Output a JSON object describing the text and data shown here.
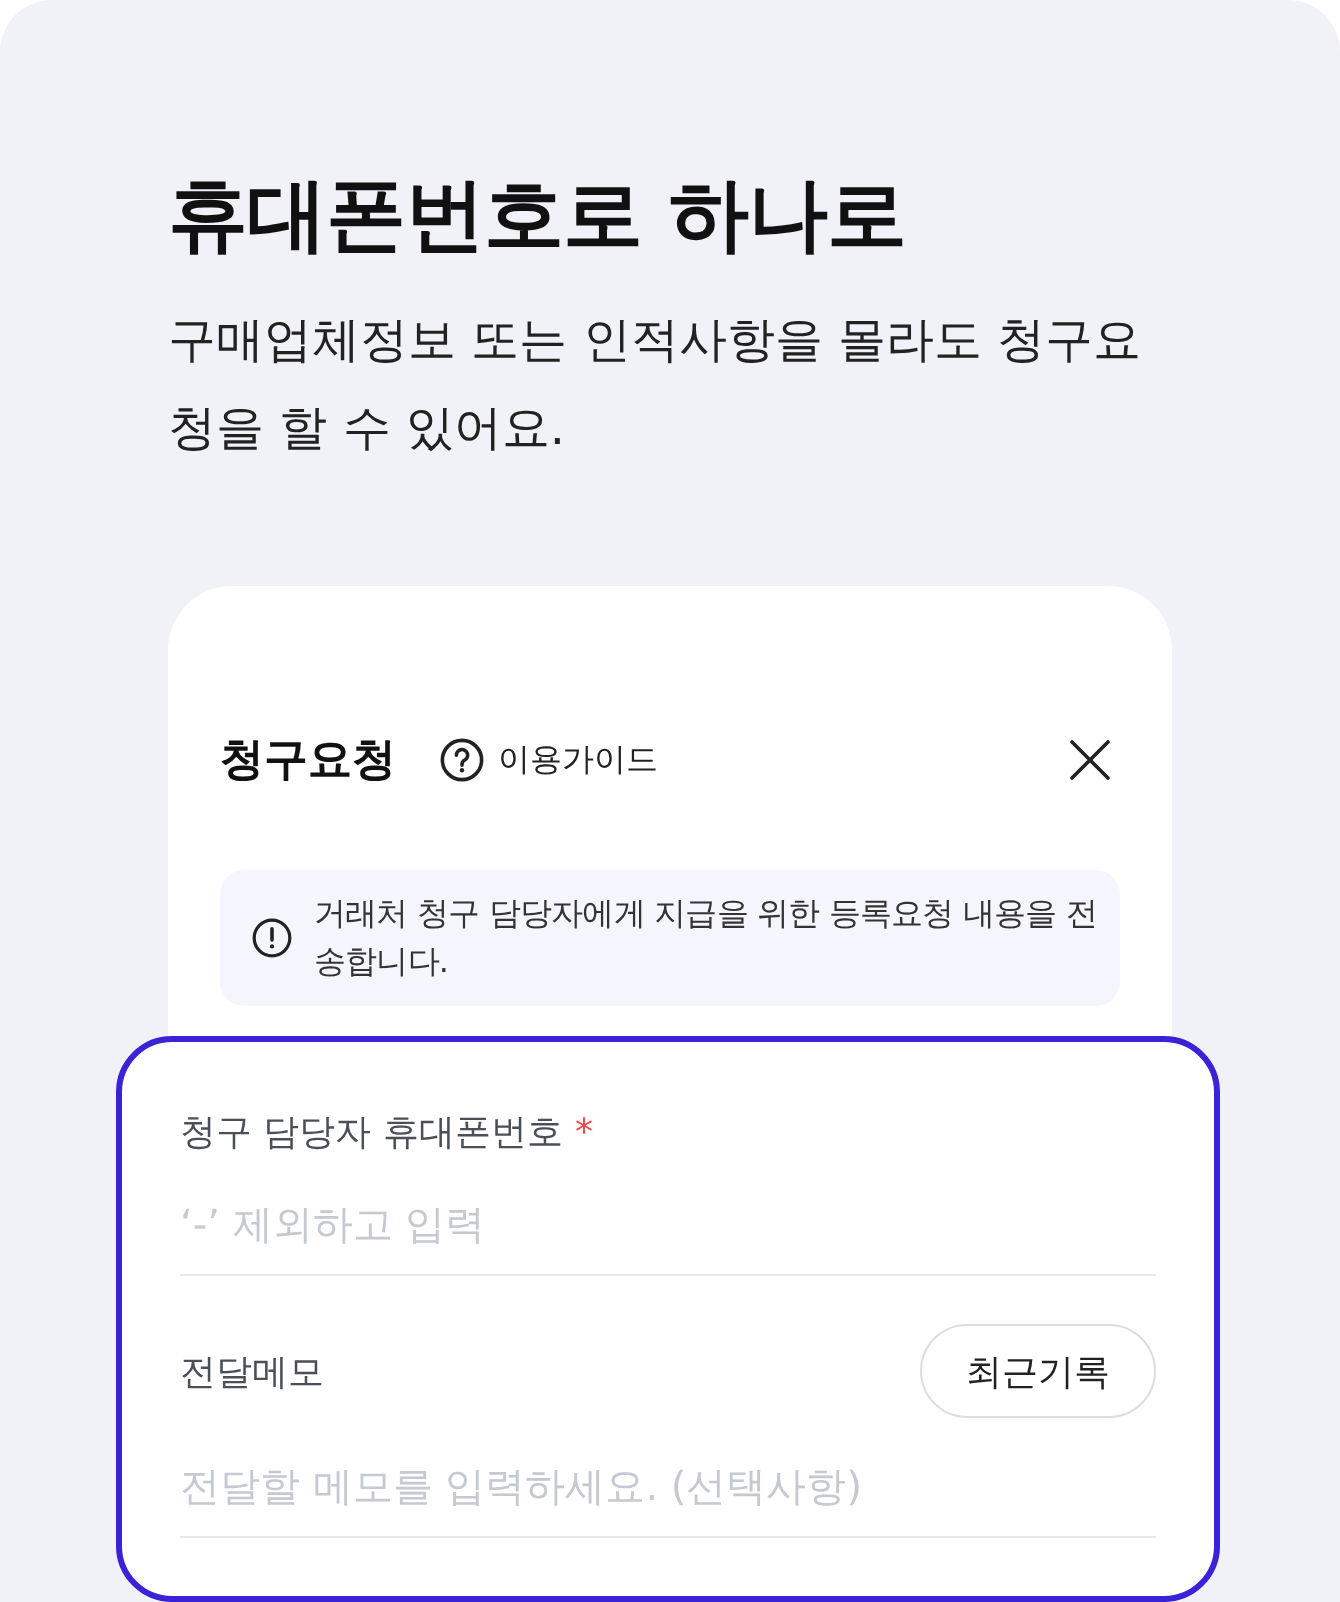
{
  "hero": {
    "title": "휴대폰번호로 하나로",
    "subtitle": "구매업체정보 또는 인적사항을 몰라도 청구요청을 할 수 있어요."
  },
  "dialog": {
    "title": "청구요청",
    "guide_link": "이용가이드",
    "notice": "거래처 청구 담당자에게 지급을 위한 등록요청 내용을 전송합니다.",
    "fields": [
      {
        "label": "청구 담당자 휴대폰번호",
        "required_mark": "*",
        "placeholder": "‘-’ 제외하고 입력"
      },
      {
        "label": "전달메모",
        "action": "최근기록",
        "placeholder": "전달할 메모를 입력하세요. (선택사항)"
      }
    ]
  }
}
